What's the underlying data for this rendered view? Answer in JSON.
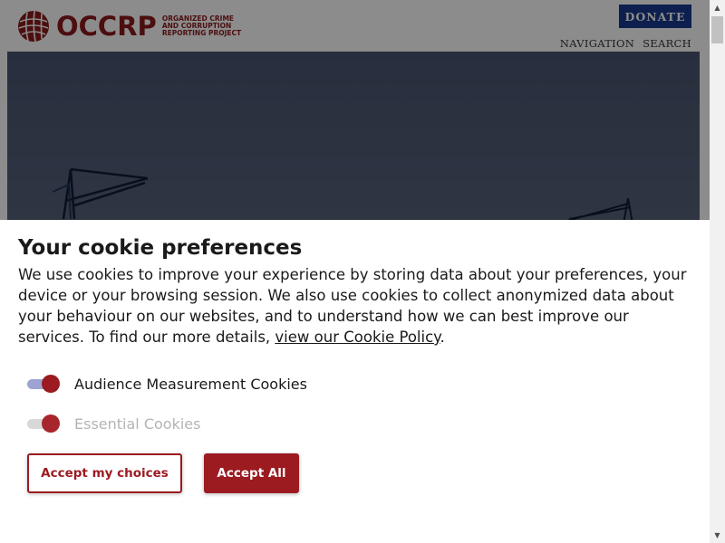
{
  "header": {
    "logo_text": "OCCRP",
    "logo_tagline": [
      "ORGANIZED CRIME",
      "AND CORRUPTION",
      "REPORTING PROJECT"
    ],
    "donate_label": "DONATE",
    "nav": [
      {
        "label": "NAVIGATION"
      },
      {
        "label": "SEARCH"
      }
    ]
  },
  "cookie_dialog": {
    "title": "Your cookie preferences",
    "body_text": "We use cookies to improve your experience by storing data about your preferences, your device or your browsing session. We also use cookies to collect anonymized data about your behaviour on our websites, and to understand how we can best improve our services. To find our more details, ",
    "policy_link_text": "view our Cookie Policy",
    "body_suffix": ".",
    "toggles": [
      {
        "label": "Audience Measurement Cookies",
        "checked": true,
        "disabled": false
      },
      {
        "label": "Essential Cookies",
        "checked": true,
        "disabled": true
      }
    ],
    "buttons": {
      "accept_choices": "Accept my choices",
      "accept_all": "Accept All"
    }
  },
  "colors": {
    "brand": "#9b1b21",
    "donate": "#163a8f"
  }
}
